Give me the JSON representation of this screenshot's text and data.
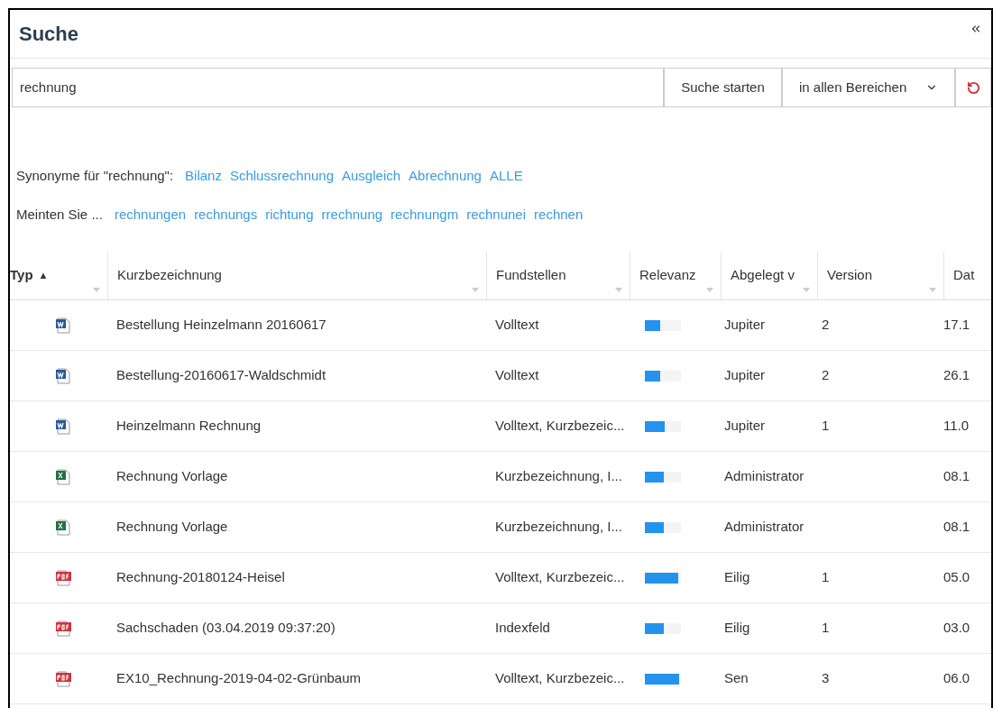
{
  "panel": {
    "title": "Suche"
  },
  "search": {
    "value": "rechnung",
    "submit": "Suche starten",
    "scope": "in allen Bereichen"
  },
  "synonyms": {
    "label": "Synonyme für \"rechnung\":",
    "links": [
      "Bilanz",
      "Schlussrechnung",
      "Ausgleich",
      "Abrechnung",
      "ALLE"
    ]
  },
  "suggestions": {
    "label": "Meinten Sie ...",
    "links": [
      "rechnungen",
      "rechnungs",
      "richtung",
      "rrechnung",
      "rechnungm",
      "rechnunei",
      "rechnen"
    ]
  },
  "table": {
    "columns": [
      {
        "label": "Typ",
        "sort": "▲"
      },
      {
        "label": "Kurzbezeichnung"
      },
      {
        "label": "Fundstellen"
      },
      {
        "label": "Relevanz"
      },
      {
        "label": "Abgelegt v"
      },
      {
        "label": "Version"
      },
      {
        "label": "Dat"
      }
    ],
    "rows": [
      {
        "kind": "word",
        "name": "Bestellung Heinzelmann 20160617",
        "found": "Volltext",
        "level": 0.42,
        "filed_by": "Jupiter",
        "version": "2",
        "date": "17.1"
      },
      {
        "kind": "word",
        "name": "Bestellung-20160617-Waldschmidt",
        "found": "Volltext",
        "level": 0.42,
        "filed_by": "Jupiter",
        "version": "2",
        "date": "26.1"
      },
      {
        "kind": "word",
        "name": "Heinzelmann Rechnung",
        "found": "Volltext, Kurzbezeic...",
        "level": 0.55,
        "filed_by": "Jupiter",
        "version": "1",
        "date": "11.0"
      },
      {
        "kind": "excel",
        "name": "Rechnung Vorlage",
        "found": "Kurzbezeichnung, I...",
        "level": 0.52,
        "filed_by": "Administrator",
        "date": "08.1"
      },
      {
        "kind": "excel",
        "name": "Rechnung Vorlage",
        "found": "Kurzbezeichnung, I...",
        "level": 0.52,
        "filed_by": "Administrator",
        "date": "08.1"
      },
      {
        "kind": "pdf",
        "name": "Rechnung-20180124-Heisel",
        "found": "Volltext, Kurzbezeic...",
        "level": 0.93,
        "filed_by": "Eilig",
        "version": "1",
        "date": "05.0"
      },
      {
        "kind": "pdf",
        "name": "Sachschaden (03.04.2019 09:37:20)",
        "found": "Indexfeld",
        "level": 0.52,
        "filed_by": "Eilig",
        "version": "1",
        "date": "03.0"
      },
      {
        "kind": "pdf",
        "name": "EX10_Rechnung-2019-04-02-Grünbaum",
        "found": "Volltext, Kurzbezeic...",
        "level": 0.95,
        "filed_by": "Sen",
        "version": "3",
        "date": "06.0"
      }
    ]
  }
}
